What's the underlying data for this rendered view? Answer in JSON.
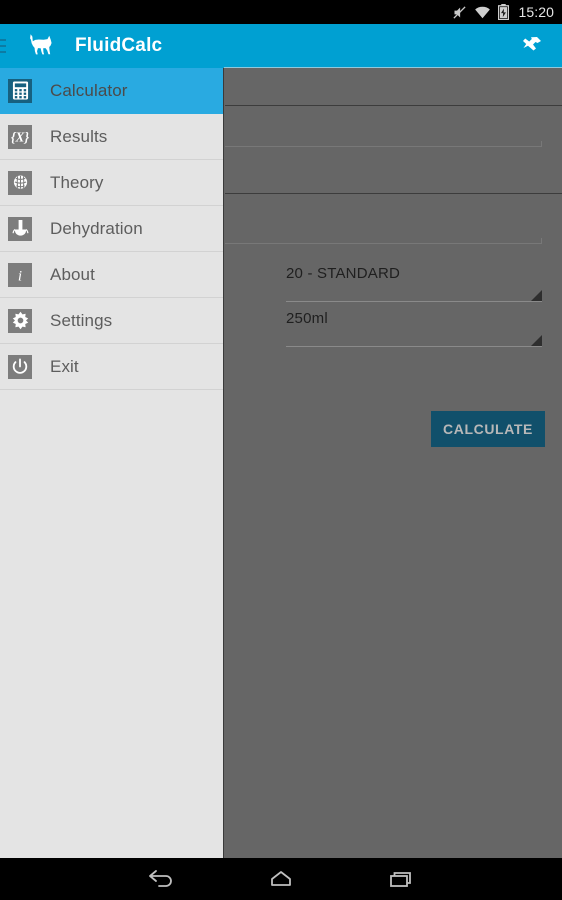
{
  "status_bar": {
    "time": "15:20",
    "icons": [
      "mute-icon",
      "wifi-icon",
      "battery-charging-icon"
    ]
  },
  "app_bar": {
    "title": "FluidCalc",
    "menu_icon": "hamburger-menu-icon",
    "logo_icon": "dog-logo-icon",
    "action_icon": "pin-icon",
    "background_color": "#00a0d2"
  },
  "drawer": {
    "background_color": "#e4e4e4",
    "selected_color": "#29aae1",
    "items": [
      {
        "label": "Calculator",
        "icon": "calculator-icon",
        "selected": true
      },
      {
        "label": "Results",
        "icon": "formula-icon",
        "selected": false
      },
      {
        "label": "Theory",
        "icon": "brain-icon",
        "selected": false
      },
      {
        "label": "Dehydration",
        "icon": "droplet-icon",
        "selected": false
      },
      {
        "label": "About",
        "icon": "info-icon",
        "selected": false
      },
      {
        "label": "Settings",
        "icon": "gear-icon",
        "selected": false
      },
      {
        "label": "Exit",
        "icon": "power-icon",
        "selected": false
      }
    ]
  },
  "form": {
    "scrim_color": "#666666",
    "drip_rate": {
      "value": "20 - STANDARD",
      "arrow_icon": "spinner-arrow-icon"
    },
    "bag_volume": {
      "value": "250ml",
      "arrow_icon": "spinner-arrow-icon"
    },
    "calculate_label": "CALCULATE",
    "calculate_color": "#11506b"
  },
  "nav_bar": {
    "back_label": "back-icon",
    "home_label": "home-icon",
    "recents_label": "recents-icon"
  }
}
